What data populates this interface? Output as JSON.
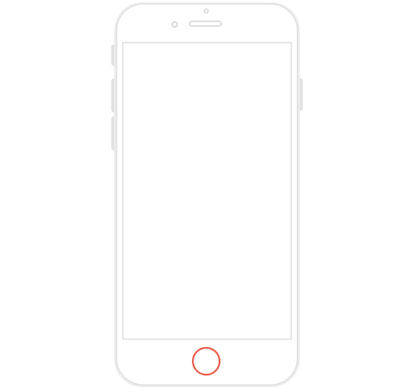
{
  "device": {
    "type": "smartphone",
    "orientation": "portrait",
    "screen": {
      "state": "blank",
      "color": "#ffffff"
    },
    "colors": {
      "body_outline": "#dcdcdc",
      "body_fill": "#ffffff",
      "screen_border": "#d2d2d2",
      "side_buttons": "#e3e3e3",
      "sensors": "#c8c8c8",
      "home_button_ring": "#e8412c"
    }
  }
}
